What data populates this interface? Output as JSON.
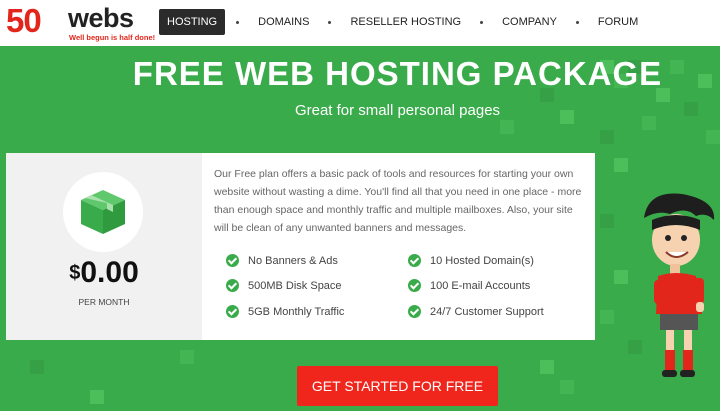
{
  "logo": {
    "number": "50",
    "word": "webs",
    "tagline": "Well begun is half done!"
  },
  "nav": [
    {
      "label": "HOSTING",
      "active": true
    },
    {
      "label": "DOMAINS",
      "active": false
    },
    {
      "label": "RESELLER HOSTING",
      "active": false
    },
    {
      "label": "COMPANY",
      "active": false
    },
    {
      "label": "FORUM",
      "active": false
    }
  ],
  "hero": {
    "title": "FREE WEB HOSTING PACKAGE",
    "subtitle": "Great for small personal pages"
  },
  "plan": {
    "currency": "$",
    "price": "0.00",
    "period": "PER MONTH",
    "description": "Our Free plan offers a basic pack of tools and resources for starting your own website without wasting a dime. You'll find all that you need in one place - more than enough space and monthly traffic and multiple mailboxes. Also, your site will be clean of any unwanted banners and messages.",
    "features_left": [
      "No Banners & Ads",
      "500MB Disk Space",
      "5GB Monthly Traffic"
    ],
    "features_right": [
      "10 Hosted Domain(s)",
      "100 E-mail Accounts",
      "24/7 Customer Support"
    ]
  },
  "cta": {
    "label": "GET STARTED FOR FREE"
  },
  "colors": {
    "brand_green": "#3aab4a",
    "cta_red": "#f0261c",
    "logo_red": "#e2261c",
    "nav_active": "#2b2b2b"
  },
  "icons": [
    "box-icon",
    "check-icon",
    "mascot-illustration"
  ]
}
